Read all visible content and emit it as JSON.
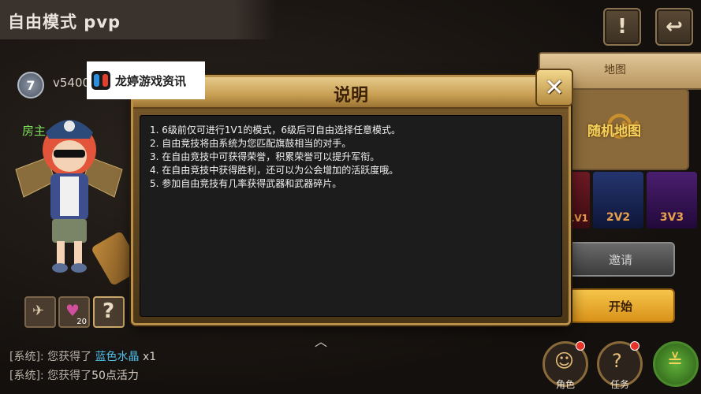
{
  "header": {
    "title": "自由模式 pvp"
  },
  "player": {
    "rank": "7",
    "id": "v5400",
    "guild": "房主"
  },
  "inventory": {
    "slot2_count": "20",
    "slot3_symbol": "?"
  },
  "chat": [
    {
      "prefix": "[系统]: 您获得了 ",
      "highlight": "蓝色水晶",
      "suffix": " x1"
    },
    {
      "prefix": "[系统]: 您获得了",
      "highlight": "",
      "suffix": "50点活力"
    }
  ],
  "right_panel": {
    "map_label": "地图",
    "random_map_label": "随机地图",
    "modes": [
      "1V1",
      "2V2",
      "3V3"
    ],
    "invite_label": "邀请",
    "start_label": "开始"
  },
  "bottom_nav": {
    "role_label": "角色",
    "task_label": "任务"
  },
  "dialog": {
    "title": "说明",
    "lines": [
      "1. 6级前仅可进行1V1的模式，6级后可自由选择任意模式。",
      "2. 自由竞技将由系统为您匹配旗鼓相当的对手。",
      "3. 在自由竞技中可获得荣誉，积累荣誉可以提升军衔。",
      "4. 在自由竞技中获得胜利，还可以为公会增加的活跃度哦。",
      "5. 参加自由竞技有几率获得武器和武器碎片。"
    ]
  },
  "watermark": {
    "text": "龙婷游戏资讯"
  },
  "colors": {
    "chat_highlight": "#4fbfe8",
    "guild_tag": "#7ee05e",
    "random_map_text": "#f3d35a"
  }
}
